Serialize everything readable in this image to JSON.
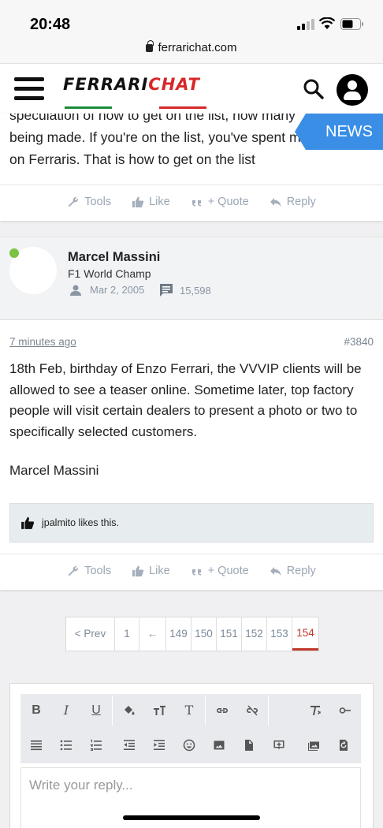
{
  "status_bar": {
    "time": "20:48"
  },
  "browser": {
    "url": "ferrarichat.com"
  },
  "header": {
    "logo_part1": "FERRARI",
    "logo_part2": "CHAT"
  },
  "news_badge": {
    "label": "NEWS"
  },
  "post1": {
    "lines": [
      "speculation of how to get on the list, how many",
      "being made. If you're on the list, you've spent m",
      "on Ferraris. That is how to get on the list"
    ]
  },
  "actions": {
    "tools": "Tools",
    "like": "Like",
    "quote": "+ Quote",
    "reply": "Reply"
  },
  "author": {
    "name": "Marcel Massini",
    "title": "F1 World Champ",
    "joined": "Mar 2, 2005",
    "post_count": "15,598"
  },
  "post2": {
    "time": "7 minutes ago",
    "number": "#3840",
    "body": "18th Feb, birthday of Enzo Ferrari, the VVVIP clients will be allowed to see a teaser online. Sometime later, top factory people will visit certain dealers to present a photo or two to specifically selected customers.",
    "signature": "Marcel Massini",
    "likes": "jpalmito likes this."
  },
  "pagination": {
    "prev": "< Prev",
    "pages": [
      "1",
      "←",
      "149",
      "150",
      "151",
      "152",
      "153",
      "154"
    ],
    "current": "154"
  },
  "editor": {
    "placeholder": "Write your reply...",
    "toolbar_row1": [
      "B",
      "I",
      "U",
      "fill-color-icon",
      "font-size-icon",
      "T",
      "link-icon",
      "unlink-icon",
      "",
      "clear-format-icon",
      "toggle-icon"
    ],
    "toolbar_row2": [
      "align-icon",
      "bullet-list-icon",
      "number-list-icon",
      "outdent-icon",
      "indent-icon",
      "smiley-icon",
      "image-icon",
      "file-icon",
      "media-icon",
      "gallery-icon",
      "undo-icon"
    ]
  },
  "colors": {
    "accent": "#c0392b",
    "news": "#3a8ee6",
    "online": "#7cc243"
  }
}
